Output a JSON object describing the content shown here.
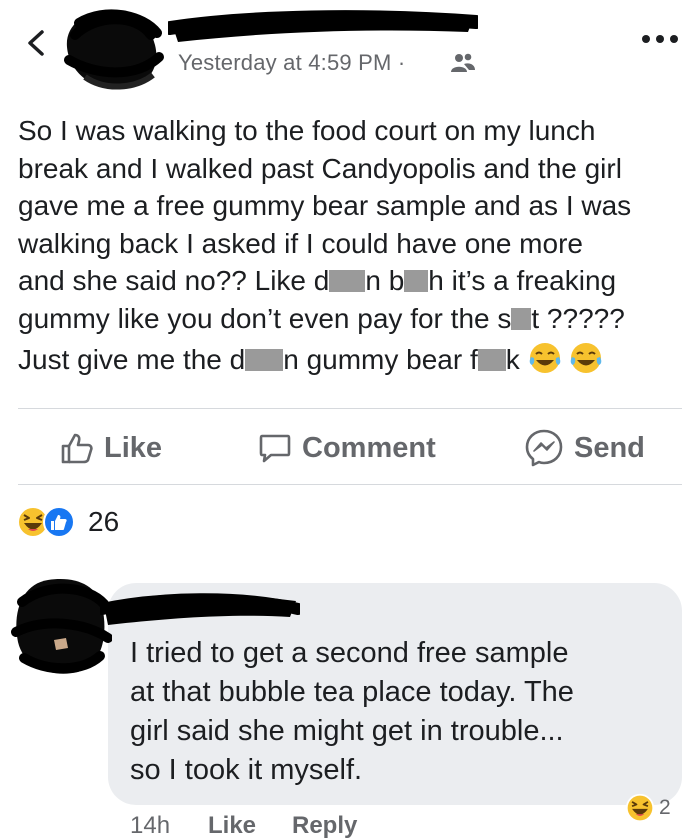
{
  "header": {
    "timestamp": "Yesterday at 4:59 PM ·"
  },
  "post": {
    "lines": [
      [
        "So I was walking to the food court on my lunch"
      ],
      [
        "break and I walked past Candyopolis and the girl"
      ],
      [
        "gave me a free gummy bear sample and as I was"
      ],
      [
        "walking back I asked if I could have one more"
      ],
      [
        "and she said no?? Like d",
        "n b",
        "h it’s a freaking"
      ],
      [
        "gummy like you don’t even pay for the s",
        "t ?????"
      ]
    ],
    "last_line": [
      "Just give me the d",
      "n gummy bear f",
      "k"
    ]
  },
  "actions": {
    "like": "Like",
    "comment": "Comment",
    "send": "Send"
  },
  "reactions": {
    "count": "26"
  },
  "comment": {
    "text_lines": [
      "I tried to get a second free sample",
      "at that bubble tea place today. The",
      "girl said she might get in trouble...",
      "so I took it myself."
    ],
    "time": "14h",
    "like": "Like",
    "reply": "Reply",
    "reaction_count": "2"
  },
  "colors": {
    "text": "#1c1e21",
    "secondary": "#65676b",
    "bubble": "#ebedf0",
    "like_blue": "#1877f2",
    "haha_yellow": "#f7c22e"
  }
}
